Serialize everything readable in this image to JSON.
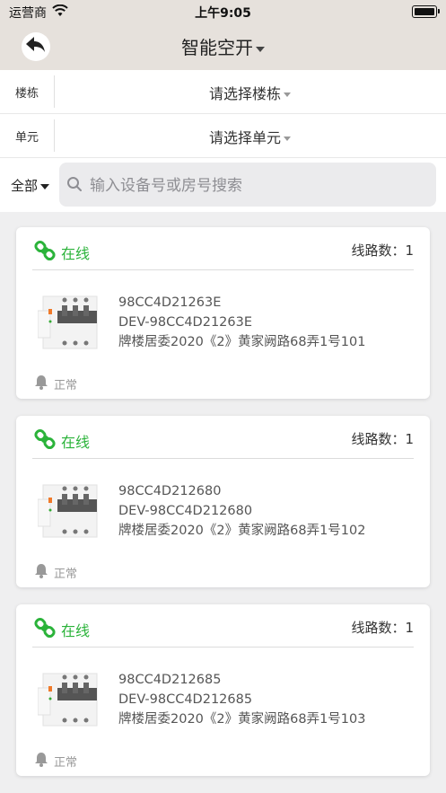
{
  "status_bar": {
    "carrier": "运营商",
    "time": "上午9:05"
  },
  "nav": {
    "title": "智能空开"
  },
  "filters": [
    {
      "label": "楼栋",
      "value": "请选择楼栋"
    },
    {
      "label": "单元",
      "value": "请选择单元"
    }
  ],
  "search": {
    "scope": "全部",
    "placeholder": "输入设备号或房号搜索"
  },
  "devices": [
    {
      "status": "在线",
      "lines_label": "线路数：1",
      "code": "98CC4D21263E",
      "dev_id": "DEV-98CC4D21263E",
      "address": "牌楼居委2020《2》黄家阙路68弄1号101",
      "state": "正常"
    },
    {
      "status": "在线",
      "lines_label": "线路数：1",
      "code": "98CC4D212680",
      "dev_id": "DEV-98CC4D212680",
      "address": "牌楼居委2020《2》黄家阙路68弄1号102",
      "state": "正常"
    },
    {
      "status": "在线",
      "lines_label": "线路数：1",
      "code": "98CC4D212685",
      "dev_id": "DEV-98CC4D212685",
      "address": "牌楼居委2020《2》黄家阙路68弄1号103",
      "state": "正常"
    }
  ],
  "colors": {
    "online": "#2bb33a",
    "nav_bg": "#e6e1dc"
  }
}
